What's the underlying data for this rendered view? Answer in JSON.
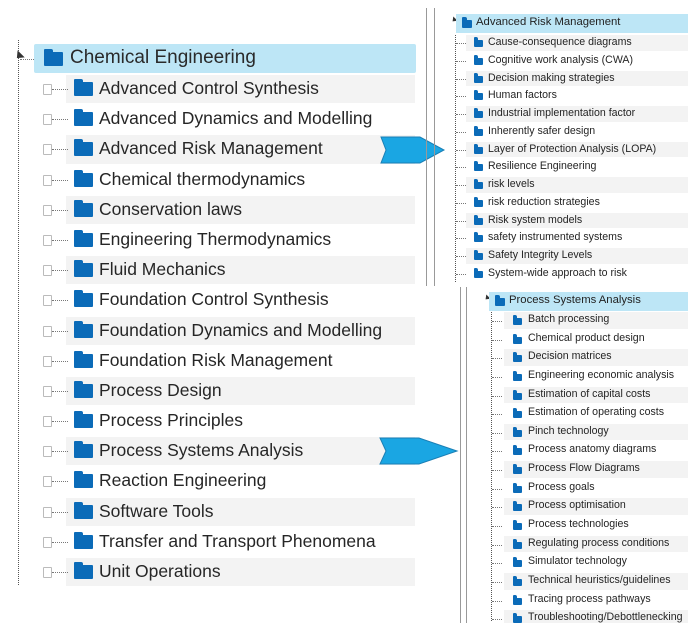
{
  "colors": {
    "folder": "#0b6bb8",
    "highlight": "#bde6f6",
    "arrow_fill": "#1aa6e3",
    "arrow_stroke": "#1a7fb5",
    "row_band": "#f3f3f3"
  },
  "icons": {
    "folder": "folder-icon",
    "collapse": "collapse-triangle-icon",
    "expand": "expand-box-icon"
  },
  "main_tree": {
    "root": "Chemical Engineering",
    "items": [
      "Advanced Control Synthesis",
      "Advanced Dynamics and Modelling",
      "Advanced Risk Management",
      "Chemical thermodynamics",
      "Conservation laws",
      "Engineering Thermodynamics",
      "Fluid Mechanics",
      "Foundation Control Synthesis",
      "Foundation Dynamics and Modelling",
      "Foundation Risk Management",
      "Process Design",
      "Process Principles",
      "Process Systems Analysis",
      "Reaction Engineering",
      "Software Tools",
      "Transfer and Transport Phenomena",
      "Unit Operations"
    ]
  },
  "risk_panel": {
    "title": "Advanced Risk Management",
    "items": [
      "Cause-consequence diagrams",
      "Cognitive work analysis (CWA)",
      "Decision making strategies",
      "Human factors",
      "Industrial implementation factor",
      "Inherently safer design",
      "Layer of Protection Analysis (LOPA)",
      "Resilience Engineering",
      "risk levels",
      "risk reduction strategies",
      "Risk system models",
      "safety instrumented systems",
      "Safety Integrity Levels",
      "System-wide approach to risk"
    ]
  },
  "psa_panel": {
    "title": "Process Systems Analysis",
    "items": [
      "Batch processing",
      "Chemical product design",
      "Decision matrices",
      "Engineering economic analysis",
      "Estimation of capital costs",
      "Estimation of operating costs",
      "Pinch technology",
      "Process anatomy diagrams",
      "Process Flow Diagrams",
      "Process goals",
      "Process optimisation",
      "Process technologies",
      "Regulating process conditions",
      "Simulator technology",
      "Technical heuristics/guidelines",
      "Tracing process pathways",
      "Troubleshooting/Debottlenecking"
    ]
  }
}
